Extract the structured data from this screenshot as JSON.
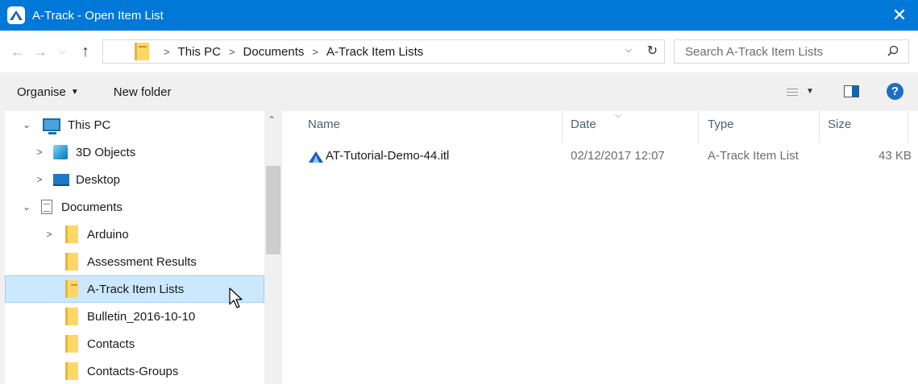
{
  "window": {
    "title": "A-Track - Open Item List",
    "close_glyph": "✕"
  },
  "address": {
    "crumbs": [
      "This PC",
      "Documents",
      "A-Track Item Lists"
    ],
    "search_placeholder": "Search A-Track Item Lists"
  },
  "toolbar": {
    "organise_label": "Organise",
    "new_folder_label": "New folder",
    "help_label": "?"
  },
  "nav_tree": {
    "items": [
      {
        "label": "This PC",
        "icon": "computer-icon",
        "expander": "expanded"
      },
      {
        "label": "3D Objects",
        "icon": "3d-objects-icon",
        "expander": "collapsed"
      },
      {
        "label": "Desktop",
        "icon": "desktop-icon",
        "expander": "collapsed"
      },
      {
        "label": "Documents",
        "icon": "documents-icon",
        "expander": "expanded"
      },
      {
        "label": "Arduino",
        "icon": "folder-icon",
        "expander": "collapsed"
      },
      {
        "label": "Assessment Results",
        "icon": "folder-icon",
        "expander": "none"
      },
      {
        "label": "A-Track Item Lists",
        "icon": "folder-icon",
        "expander": "none",
        "selected": true
      },
      {
        "label": "Bulletin_2016-10-10",
        "icon": "folder-icon",
        "expander": "none"
      },
      {
        "label": "Contacts",
        "icon": "folder-icon",
        "expander": "none"
      },
      {
        "label": "Contacts-Groups",
        "icon": "folder-icon",
        "expander": "none"
      }
    ]
  },
  "file_list": {
    "columns": [
      "Name",
      "Date",
      "Type",
      "Size"
    ],
    "rows": [
      {
        "name": "AT-Tutorial-Demo-44.itl",
        "date": "02/12/2017 12:07",
        "type": "A-Track Item List",
        "size": "43 KB"
      }
    ]
  },
  "colors": {
    "titlebar": "#0078d7",
    "selection": "#cce8ff",
    "column_header_text": "#4c607a"
  }
}
